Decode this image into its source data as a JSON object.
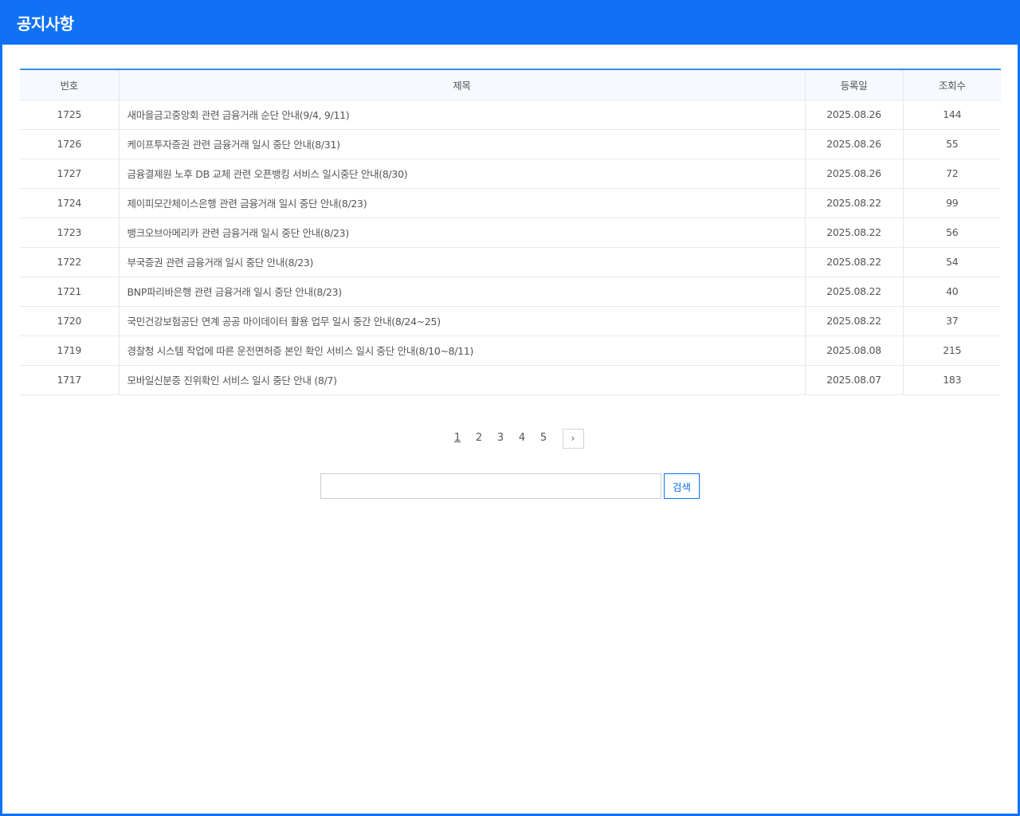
{
  "header": {
    "title": "공지사항"
  },
  "table": {
    "columns": {
      "no": "번호",
      "title": "제목",
      "date": "등록일",
      "views": "조회수"
    },
    "rows": [
      {
        "no": "1725",
        "title": "새마을금고중앙회 관련 금융거래 순단 안내(9/4, 9/11)",
        "date": "2025.08.26",
        "views": "144"
      },
      {
        "no": "1726",
        "title": "케이프투자증권 관련 금융거래 일시 중단 안내(8/31)",
        "date": "2025.08.26",
        "views": "55"
      },
      {
        "no": "1727",
        "title": "금융결제원 노후 DB 교체 관련 오픈뱅킹 서비스 일시중단 안내(8/30)",
        "date": "2025.08.26",
        "views": "72"
      },
      {
        "no": "1724",
        "title": "제이피모간체이스은행 관련 금융거래 일시 중단 안내(8/23)",
        "date": "2025.08.22",
        "views": "99"
      },
      {
        "no": "1723",
        "title": "뱅크오브아메리카 관련 금융거래 일시 중단 안내(8/23)",
        "date": "2025.08.22",
        "views": "56"
      },
      {
        "no": "1722",
        "title": "부국증권 관련 금융거래 일시 중단 안내(8/23)",
        "date": "2025.08.22",
        "views": "54"
      },
      {
        "no": "1721",
        "title": "BNP파리바은행 관련 금융거래 일시 중단 안내(8/23)",
        "date": "2025.08.22",
        "views": "40"
      },
      {
        "no": "1720",
        "title": "국민건강보험공단 연계 공공 마이데이터 활용 업무 일시 중간 안내(8/24~25)",
        "date": "2025.08.22",
        "views": "37"
      },
      {
        "no": "1719",
        "title": "경찰청 시스템 작업에 따른 운전면허증 본인 확인 서비스 일시 중단 안내(8/10~8/11)",
        "date": "2025.08.08",
        "views": "215"
      },
      {
        "no": "1717",
        "title": "모바일신분증 진위확인 서비스 일시 중단 안내 (8/7)",
        "date": "2025.08.07",
        "views": "183"
      }
    ]
  },
  "pagination": {
    "pages": [
      "1",
      "2",
      "3",
      "4",
      "5"
    ],
    "current": "1",
    "next_icon": "chevron-right-icon",
    "next_glyph": "›"
  },
  "search": {
    "value": "",
    "placeholder": "",
    "button_label": "검색"
  },
  "colors": {
    "brand": "#1071f4",
    "table_top_border": "#3a8ee6"
  }
}
